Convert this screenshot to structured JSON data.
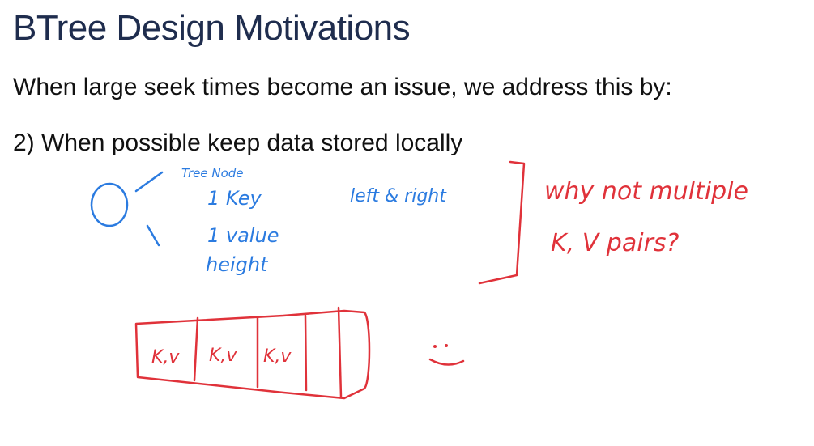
{
  "slide": {
    "title": "BTree Design Motivations",
    "intro": "When large seek times become an issue, we address this by:",
    "point": "2) When possible keep data stored locally"
  },
  "annotations": {
    "tree_node": "Tree Node",
    "key": "1  Key",
    "value": "1  value",
    "height": "height",
    "left_right": "left & right",
    "question_line1": "why not multiple",
    "question_line2": "K, V pairs?",
    "cells": [
      "K,v",
      "K,v",
      "K,v"
    ]
  },
  "colors": {
    "blue_ink": "#2b7be0",
    "red_ink": "#e0323a",
    "title": "#1f2d4e"
  }
}
